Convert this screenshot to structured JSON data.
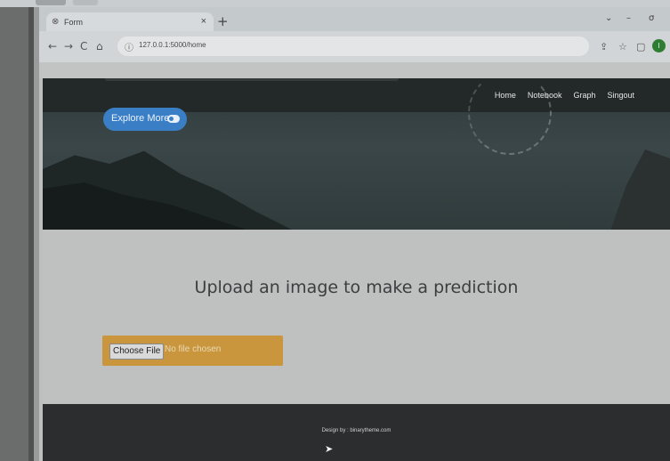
{
  "browser": {
    "tab_title": "Form",
    "tab_close": "×",
    "new_tab": "+",
    "url": "127.0.0.1:5000/home",
    "profile_initial": "I",
    "window_controls": [
      "⌄",
      "–",
      "σ"
    ]
  },
  "page": {
    "nav": [
      "Home",
      "Notebook",
      "Graph",
      "Singout"
    ],
    "explore_button": "Explore More",
    "upload_title": "Upload an image to make a prediction",
    "choose_file_label": "Choose File",
    "file_status": "No file chosen",
    "footer_credit": "Design by : binarytheme.com"
  },
  "colors": {
    "explore_button": "#3a7fc6",
    "file_box": "#c9963d",
    "footer": "#2b2d2f",
    "profile": "#2e7d32"
  }
}
